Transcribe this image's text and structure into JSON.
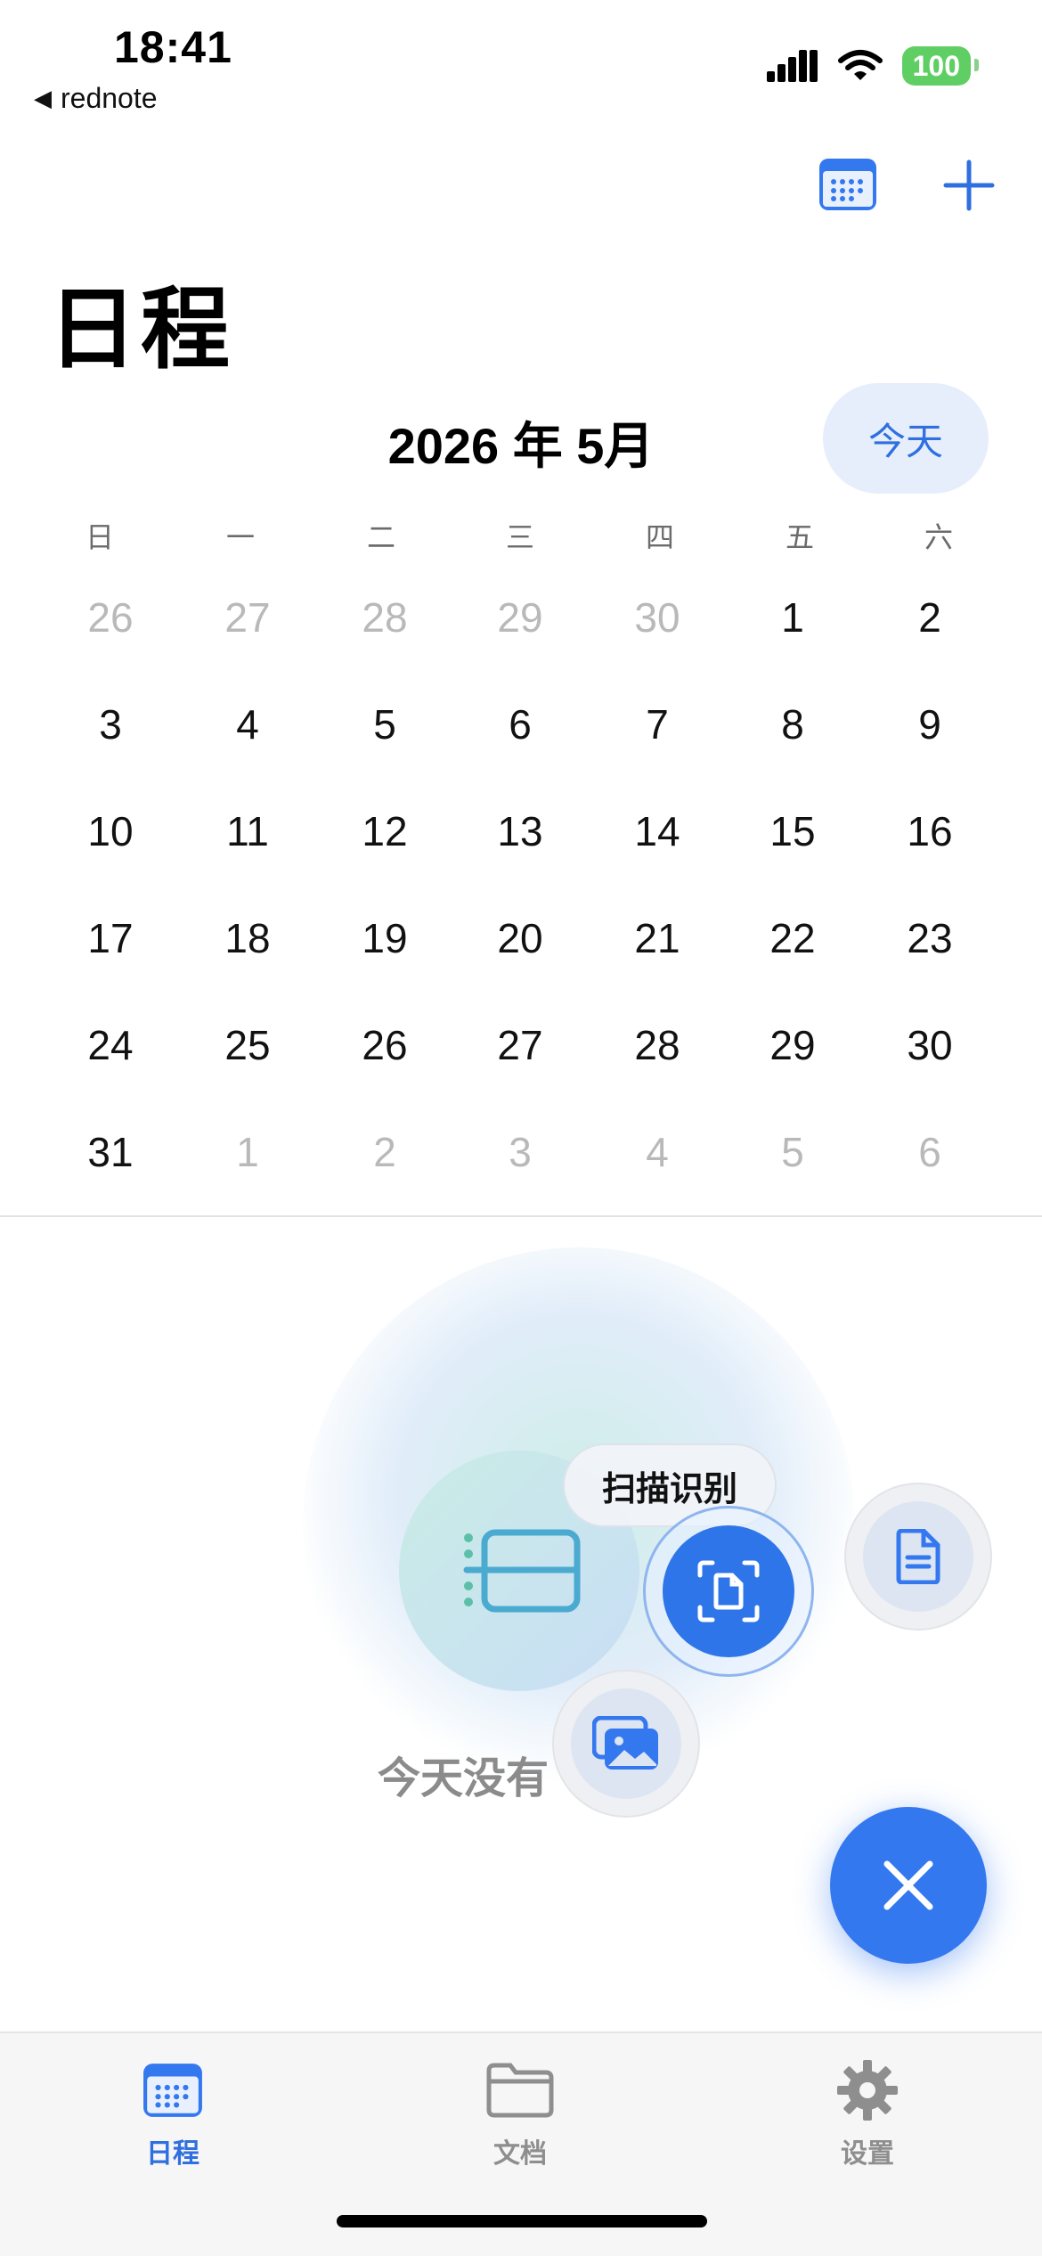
{
  "status_bar": {
    "time": "18:41",
    "back_app": "rednote",
    "battery": "100"
  },
  "header": {
    "title": "日程",
    "calendar_button_icon": "calendar-icon",
    "add_button_icon": "plus-icon"
  },
  "calendar": {
    "month_title": "2026 年 5月",
    "today_label": "今天",
    "weekdays": [
      "日",
      "一",
      "二",
      "三",
      "四",
      "五",
      "六"
    ],
    "weeks": [
      [
        {
          "d": "26",
          "dim": true
        },
        {
          "d": "27",
          "dim": true
        },
        {
          "d": "28",
          "dim": true
        },
        {
          "d": "29",
          "dim": true
        },
        {
          "d": "30",
          "dim": true
        },
        {
          "d": "1",
          "dim": false
        },
        {
          "d": "2",
          "dim": false
        }
      ],
      [
        {
          "d": "3",
          "dim": false
        },
        {
          "d": "4",
          "dim": false
        },
        {
          "d": "5",
          "dim": false
        },
        {
          "d": "6",
          "dim": false
        },
        {
          "d": "7",
          "dim": false
        },
        {
          "d": "8",
          "dim": false
        },
        {
          "d": "9",
          "dim": false
        }
      ],
      [
        {
          "d": "10",
          "dim": false
        },
        {
          "d": "11",
          "dim": false
        },
        {
          "d": "12",
          "dim": false
        },
        {
          "d": "13",
          "dim": false
        },
        {
          "d": "14",
          "dim": false
        },
        {
          "d": "15",
          "dim": false
        },
        {
          "d": "16",
          "dim": false
        }
      ],
      [
        {
          "d": "17",
          "dim": false
        },
        {
          "d": "18",
          "dim": false
        },
        {
          "d": "19",
          "dim": false
        },
        {
          "d": "20",
          "dim": false
        },
        {
          "d": "21",
          "dim": false
        },
        {
          "d": "22",
          "dim": false
        },
        {
          "d": "23",
          "dim": false
        }
      ],
      [
        {
          "d": "24",
          "dim": false
        },
        {
          "d": "25",
          "dim": false
        },
        {
          "d": "26",
          "dim": false
        },
        {
          "d": "27",
          "dim": false
        },
        {
          "d": "28",
          "dim": false
        },
        {
          "d": "29",
          "dim": false
        },
        {
          "d": "30",
          "dim": false
        }
      ],
      [
        {
          "d": "31",
          "dim": false
        },
        {
          "d": "1",
          "dim": true
        },
        {
          "d": "2",
          "dim": true
        },
        {
          "d": "3",
          "dim": true
        },
        {
          "d": "4",
          "dim": true
        },
        {
          "d": "5",
          "dim": true
        },
        {
          "d": "6",
          "dim": true
        }
      ]
    ]
  },
  "empty_state": {
    "text": "今天没有"
  },
  "fab_menu": {
    "scan_label": "扫描识别",
    "scan_icon": "scan-document-icon",
    "document_icon": "document-icon",
    "photos_icon": "photos-icon",
    "close_icon": "close-icon"
  },
  "tabbar": {
    "items": [
      {
        "label": "日程",
        "icon": "calendar-icon",
        "active": true
      },
      {
        "label": "文档",
        "icon": "folder-icon",
        "active": false
      },
      {
        "label": "设置",
        "icon": "gear-icon",
        "active": false
      }
    ]
  },
  "colors": {
    "accent": "#2f6fe0",
    "fab": "#3478f0",
    "battery": "#5fcf63",
    "dim_text": "#b9b9b9"
  }
}
